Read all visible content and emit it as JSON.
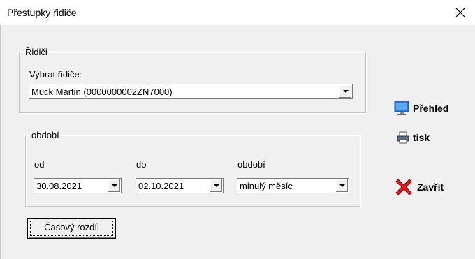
{
  "window": {
    "title": "Přestupky řidiče",
    "close_symbol": "✕"
  },
  "drivers_group": {
    "legend": "Řidiči",
    "select_label": "Vybrat řidiče:",
    "selected_driver": "Muck Martin (0000000002ZN7000)"
  },
  "period_group": {
    "legend": "období",
    "from_label": "od",
    "from_value": "30.08.2021",
    "to_label": "do",
    "to_value": "02.10.2021",
    "period_label": "období",
    "period_value": "minulý měsíc"
  },
  "time_diff_button": "Časový rozdíl",
  "actions": {
    "overview": {
      "label": "Přehled",
      "icon": "monitor-icon"
    },
    "print": {
      "label": "tisk",
      "icon": "printer-icon"
    },
    "close": {
      "label": "Zavřít",
      "icon": "red-x-icon"
    }
  }
}
